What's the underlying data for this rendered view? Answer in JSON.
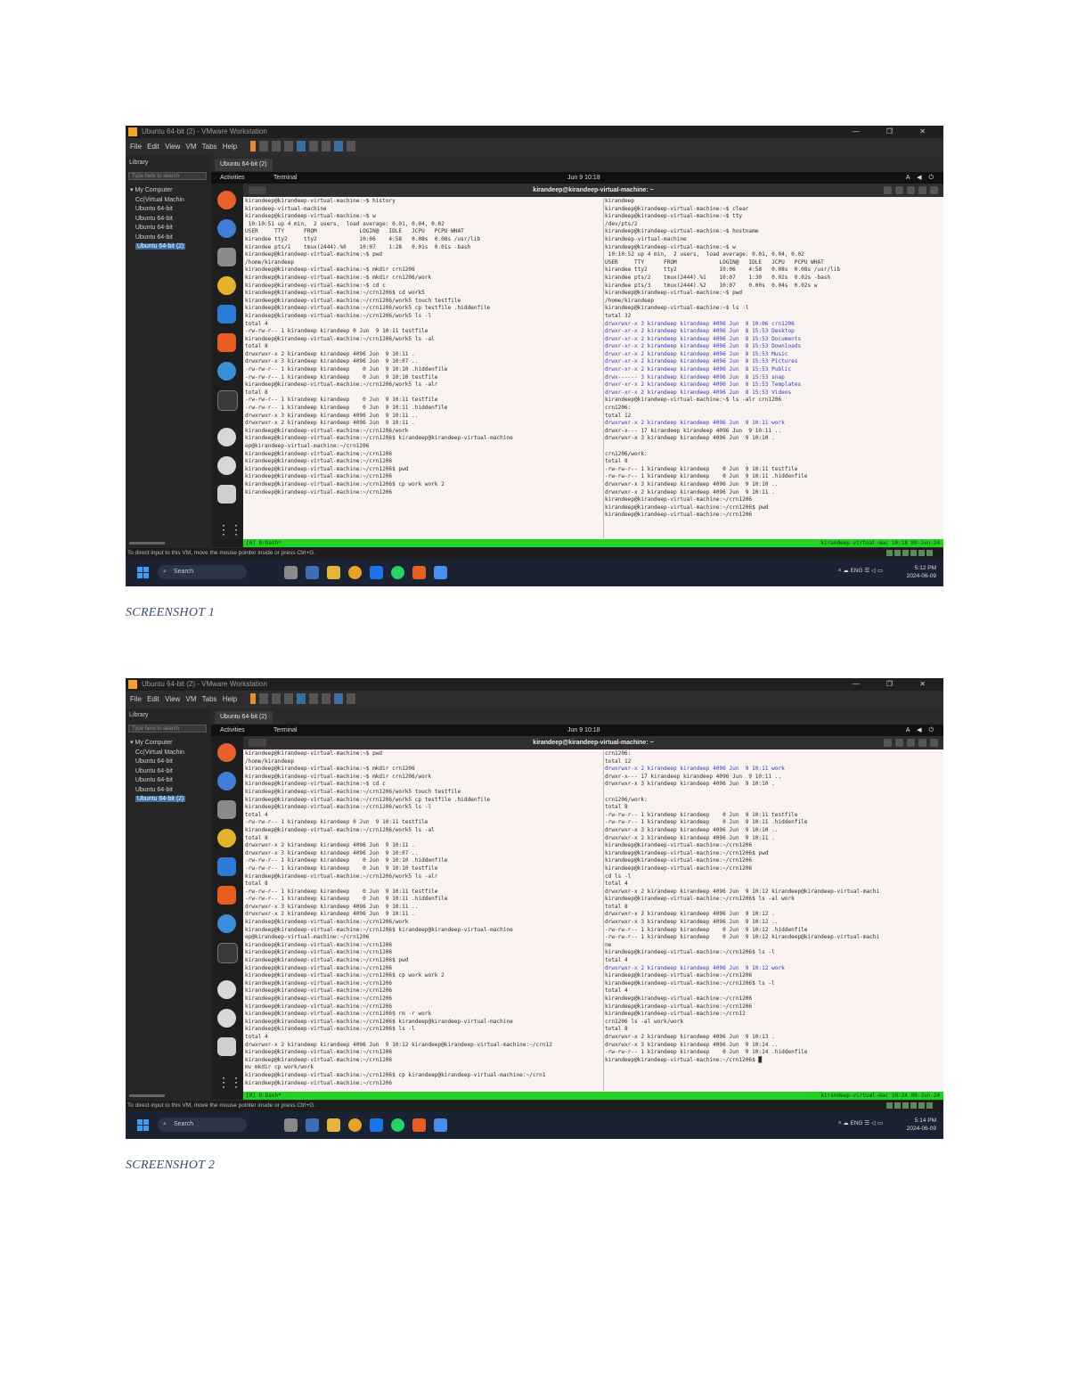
{
  "document": {
    "captions": [
      "SCREENSHOT 1",
      "SCREENSHOT 2"
    ]
  },
  "window": {
    "title": "Ubuntu 64-bit (2) - VMware Workstation",
    "menus": "File  Edit  View  VM  Tabs  Help",
    "library_title": "Library",
    "library_search": "Type here to search",
    "tree": [
      "My Computer",
      "Cc(Virtual Machin",
      "Ubuntu 64-bit",
      "Ubuntu 64-bit",
      "Ubuntu 64-bit",
      "Ubuntu 64-bit",
      "Ubuntu 64-bit (2)"
    ],
    "vm_tab": "Ubuntu 64-bit (2)",
    "infobar_text": "To direct input to this VM, move the mouse pointer inside or press Ctrl+G."
  },
  "gnome": {
    "activities": "Activities",
    "app": "Terminal",
    "clock": "Jun 9 10:18",
    "sys": "A ◀ ⏻"
  },
  "terminal": {
    "title": "kirandeep@kirandeep-virtual-machine: ~"
  },
  "taskbar": {
    "search": "Search",
    "lang": "ENG\nIN",
    "time1": "5:12 PM",
    "date1": "2024-06-09",
    "time2": "5:14 PM",
    "date2": "2024-06-09"
  },
  "shot1": {
    "left": [
      "kirandeep@kirandeep-virtual-machine:~$ history",
      "kirandeep-virtual-machine",
      "kirandeep@kirandeep-virtual-machine:~$ w",
      " 10:10:51 up 4 min,  2 users,  load average: 0.01, 0.04, 0.02",
      "USER     TTY      FROM             LOGIN@   IDLE   JCPU   PCPU WHAT",
      "kirandee tty2     tty2             10:06    4:58   0.08s  0.08s /usr/lib",
      "kirandee pts/1    tmux(2444).%0    10:07    1:28   0.01s  0.01s -bash",
      "kirandeep@kirandeep-virtual-machine:~$ pwd",
      "/home/kirandeep",
      "kirandeep@kirandeep-virtual-machine:~$ mkdir crn1206",
      "kirandeep@kirandeep-virtual-machine:~$ mkdir crn1206/work",
      "kirandeep@kirandeep-virtual-machine:~$ cd c",
      "kirandeep@kirandeep-virtual-machine:~/crn1206$ cd work5",
      "kirandeep@kirandeep-virtual-machine:~/crn1206/work5 touch testfile",
      "kirandeep@kirandeep-virtual-machine:~/crn1206/work5 cp testfile .hiddenfile",
      "kirandeep@kirandeep-virtual-machine:~/crn1206/work5 ls -l",
      "total 4",
      "-rw-rw-r-- 1 kirandeep kirandeep 0 Jun  9 10:11 testfile",
      "kirandeep@kirandeep-virtual-machine:~/crn1206/work5 ls -al",
      "total 8",
      "drwxrwxr-x 2 kirandeep kirandeep 4096 Jun  9 10:11 .",
      "drwxrwxr-x 3 kirandeep kirandeep 4096 Jun  9 10:07 ..",
      "-rw-rw-r-- 1 kirandeep kirandeep    0 Jun  9 10:10 .hiddenfile",
      "-rw-rw-r-- 1 kirandeep kirandeep    0 Jun  9 10:10 testfile",
      "kirandeep@kirandeep-virtual-machine:~/crn1206/work5 ls -alr",
      "total 8",
      "-rw-rw-r-- 1 kirandeep kirandeep    0 Jun  9 10:11 testfile",
      "-rw-rw-r-- 1 kirandeep kirandeep    0 Jun  9 10:11 .hiddenfile",
      "drwxrwxr-x 3 kirandeep kirandeep 4096 Jun  9 10:11 ..",
      "drwxrwxr-x 2 kirandeep kirandeep 4096 Jun  9 10:11 .",
      "kirandeep@kirandeep-virtual-machine:~/crn1206/work",
      "kirandeep@kirandeep-virtual-machine:~/crn1206$ kirandeep@kirandeep-virtual-machine",
      "ep@kirandeep-virtual-machine:~/crn1206",
      "kirandeep@kirandeep-virtual-machine:~/crn1206",
      "kirandeep@kirandeep-virtual-machine:~/crn1206",
      "kirandeep@kirandeep-virtual-machine:~/crn1206$ pwd",
      "kirandeep@kirandeep-virtual-machine:~/crn1206",
      "kirandeep@kirandeep-virtual-machine:~/crn1206$ cp work work 2",
      "kirandeep@kirandeep-virtual-machine:~/crn1206"
    ],
    "right": [
      "kirandeep",
      "kirandeep@kirandeep-virtual-machine:~$ clear",
      "kirandeep@kirandeep-virtual-machine:~$ tty",
      "/dev/pts/2",
      "kirandeep@kirandeep-virtual-machine:~$ hostname",
      "kirandeep-virtual-machine",
      "kirandeep@kirandeep-virtual-machine:~$ w",
      " 10:10:52 up 4 min,  2 users,  load average: 0.01, 0.04, 0.02",
      "USER     TTY      FROM             LOGIN@   IDLE   JCPU   PCPU WHAT",
      "kirandee tty2     tty2             10:06    4:58   0.08s  0.08s /usr/lib",
      "kirandee pts/2    tmux(2444).%1    10:07    1:30   0.02s  0.02s -bash",
      "kirandee pts/3    tmux(2444).%2    10:07    0.00s  0.04s  0.02s w",
      "kirandeep@kirandeep-virtual-machine:~$ pwd",
      "/home/kirandeep",
      "kirandeep@kirandeep-virtual-machine:~$ ls -l",
      "total 32",
      "drwxrwxr-x 3 kirandeep kirandeep 4096 Jun  9 10:06 crn1206",
      "drwxr-xr-x 2 kirandeep kirandeep 4096 Jun  8 15:53 Desktop",
      "drwxr-xr-x 2 kirandeep kirandeep 4096 Jun  8 15:53 Documents",
      "drwxr-xr-x 2 kirandeep kirandeep 4096 Jun  8 15:53 Downloads",
      "drwxr-xr-x 2 kirandeep kirandeep 4096 Jun  8 15:53 Music",
      "drwxr-xr-x 2 kirandeep kirandeep 4096 Jun  8 15:53 Pictures",
      "drwxr-xr-x 2 kirandeep kirandeep 4096 Jun  8 15:53 Public",
      "drwx------ 3 kirandeep kirandeep 4096 Jun  8 15:53 snap",
      "drwxr-xr-x 2 kirandeep kirandeep 4096 Jun  8 15:53 Templates",
      "drwxr-xr-x 2 kirandeep kirandeep 4096 Jun  8 15:53 Videos",
      "kirandeep@kirandeep-virtual-machine:~$ ls -alr crn1206",
      "crn1206:",
      "total 12",
      "drwxrwxr-x 2 kirandeep kirandeep 4096 Jun  9 10:11 work",
      "drwxr-x--- 17 kirandeep kirandeep 4096 Jun  9 10:11 ..",
      "drwxrwxr-x 3 kirandeep kirandeep 4096 Jun  9 10:10 .",
      "",
      "crn1206/work:",
      "total 8",
      "-rw-rw-r-- 1 kirandeep kirandeep    0 Jun  9 10:11 testfile",
      "-rw-rw-r-- 1 kirandeep kirandeep    0 Jun  9 10:11 .hiddenfile",
      "drwxrwxr-x 3 kirandeep kirandeep 4096 Jun  9 10:10 ..",
      "drwxrwxr-x 2 kirandeep kirandeep 4096 Jun  9 10:11 .",
      "kirandeep@kirandeep-virtual-machine:~/crn1206",
      "kirandeep@kirandeep-virtual-machine:~/crn1206$ pwd",
      "kirandeep@kirandeep-virtual-machine:~/crn1206"
    ],
    "status_left": "[0] 0:bash*",
    "status_right": "kirandeep-virtual-mac  10:18 09-Jun-24"
  },
  "shot2": {
    "left": [
      "kirandeep@kirandeep-virtual-machine:~$ pwd",
      "/home/kirandeep",
      "kirandeep@kirandeep-virtual-machine:~$ mkdir crn1206",
      "kirandeep@kirandeep-virtual-machine:~$ mkdir crn1206/work",
      "kirandeep@kirandeep-virtual-machine:~$ cd c",
      "kirandeep@kirandeep-virtual-machine:~/crn1206/work5 touch testfile",
      "kirandeep@kirandeep-virtual-machine:~/crn1206/work5 cp testfile .hiddenfile",
      "kirandeep@kirandeep-virtual-machine:~/crn1206/work5 ls -l",
      "total 4",
      "-rw-rw-r-- 1 kirandeep kirandeep 0 Jun  9 10:11 testfile",
      "kirandeep@kirandeep-virtual-machine:~/crn1206/work5 ls -al",
      "total 8",
      "drwxrwxr-x 2 kirandeep kirandeep 4096 Jun  9 10:11 .",
      "drwxrwxr-x 3 kirandeep kirandeep 4096 Jun  9 10:07 ..",
      "-rw-rw-r-- 1 kirandeep kirandeep    0 Jun  9 10:10 .hiddenfile",
      "-rw-rw-r-- 1 kirandeep kirandeep    0 Jun  9 10:10 testfile",
      "kirandeep@kirandeep-virtual-machine:~/crn1206/work5 ls -alr",
      "total 8",
      "-rw-rw-r-- 1 kirandeep kirandeep    0 Jun  9 10:11 testfile",
      "-rw-rw-r-- 1 kirandeep kirandeep    0 Jun  9 10:11 .hiddenfile",
      "drwxrwxr-x 3 kirandeep kirandeep 4096 Jun  9 10:11 ..",
      "drwxrwxr-x 2 kirandeep kirandeep 4096 Jun  9 10:11 .",
      "kirandeep@kirandeep-virtual-machine:~/crn1206/work",
      "kirandeep@kirandeep-virtual-machine:~/crn1206$ kirandeep@kirandeep-virtual-machine",
      "ep@kirandeep-virtual-machine:~/crn1206",
      "kirandeep@kirandeep-virtual-machine:~/crn1206",
      "kirandeep@kirandeep-virtual-machine:~/crn1206",
      "kirandeep@kirandeep-virtual-machine:~/crn1206$ pwd",
      "kirandeep@kirandeep-virtual-machine:~/crn1206",
      "kirandeep@kirandeep-virtual-machine:~/crn1206$ cp work work 2",
      "kirandeep@kirandeep-virtual-machine:~/crn1206",
      "kirandeep@kirandeep-virtual-machine:~/crn1206",
      "kirandeep@kirandeep-virtual-machine:~/crn1206",
      "kirandeep@kirandeep-virtual-machine:~/crn1206",
      "kirandeep@kirandeep-virtual-machine:~/crn1206$ rm -r work",
      "kirandeep@kirandeep-virtual-machine:~/crn1206$ kirandeep@kirandeep-virtual-machine",
      "kirandeep@kirandeep-virtual-machine:~/crn1206$ ls -l",
      "total 4",
      "drwxrwxr-x 2 kirandeep kirandeep 4096 Jun  9 10:12 kirandeep@kirandeep-virtual-machine:~/crn12",
      "kirandeep@kirandeep-virtual-machine:~/crn1206",
      "kirandeep@kirandeep-virtual-machine:~/crn1206",
      "mv mkdir cp work/work",
      "kirandeep@kirandeep-virtual-machine:~/crn1206$ cp kirandeep@kirandeep-virtual-machine:~/crn1",
      "kirandeep@kirandeep-virtual-machine:~/crn1206"
    ],
    "right": [
      "crn1206:",
      "total 12",
      "drwxrwxr-x 2 kirandeep kirandeep 4096 Jun  9 10:11 work",
      "drwxr-x--- 17 kirandeep kirandeep 4096 Jun  9 10:11 ..",
      "drwxrwxr-x 3 kirandeep kirandeep 4096 Jun  9 10:10 .",
      "",
      "crn1206/work:",
      "total 8",
      "-rw-rw-r-- 1 kirandeep kirandeep    0 Jun  9 10:11 testfile",
      "-rw-rw-r-- 1 kirandeep kirandeep    0 Jun  9 10:11 .hiddenfile",
      "drwxrwxr-x 3 kirandeep kirandeep 4096 Jun  9 10:10 ..",
      "drwxrwxr-x 2 kirandeep kirandeep 4096 Jun  9 10:11 .",
      "kirandeep@kirandeep-virtual-machine:~/crn1206",
      "kirandeep@kirandeep-virtual-machine:~/crn1206$ pwd",
      "kirandeep@kirandeep-virtual-machine:~/crn1206",
      "kirandeep@kirandeep-virtual-machine:~/crn1206",
      "cd ls -l",
      "total 4",
      "drwxrwxr-x 2 kirandeep kirandeep 4096 Jun  9 10:12 kirandeep@kirandeep-virtual-machi",
      "kirandeep@kirandeep-virtual-machine:~/crn1206$ ls -al work",
      "total 8",
      "drwxrwxr-x 2 kirandeep kirandeep 4096 Jun  9 10:12 .",
      "drwxrwxr-x 3 kirandeep kirandeep 4096 Jun  9 10:12 ..",
      "-rw-rw-r-- 1 kirandeep kirandeep    0 Jun  9 10:12 .hiddenfile",
      "-rw-rw-r-- 1 kirandeep kirandeep    0 Jun  9 10:12 kirandeep@kirandeep-virtual-machi",
      "ne",
      "kirandeep@kirandeep-virtual-machine:~/crn1206$ ls -l",
      "total 4",
      "drwxrwxr-x 2 kirandeep kirandeep 4096 Jun  9 10:12 work",
      "kirandeep@kirandeep-virtual-machine:~/crn1206",
      "kirandeep@kirandeep-virtual-machine:~/crn1206$ ls -l",
      "total 4",
      "kirandeep@kirandeep-virtual-machine:~/crn1206",
      "kirandeep@kirandeep-virtual-machine:~/crn1206",
      "kirandeep@kirandeep-virtual-machine:~/crn12",
      "crn1206 ls -al work/work",
      "total 8",
      "drwxrwxr-x 2 kirandeep kirandeep 4096 Jun  9 10:13 .",
      "drwxrwxr-x 3 kirandeep kirandeep 4096 Jun  9 10:14 ..",
      "-rw-rw-r-- 1 kirandeep kirandeep    0 Jun  9 10:14 .hiddenfile",
      "kirandeep@kirandeep-virtual-machine:~/crn1206$ █"
    ],
    "status_left": "[0] 0:bash*",
    "status_right": "kirandeep-virtual-mac  10:24 09-Jun-24"
  },
  "colors": {
    "terminal_bg": "#fbf2f2",
    "status_green": "#24d224",
    "taskbar": "#1b2333",
    "dir_blue": "#2a3fb8"
  }
}
